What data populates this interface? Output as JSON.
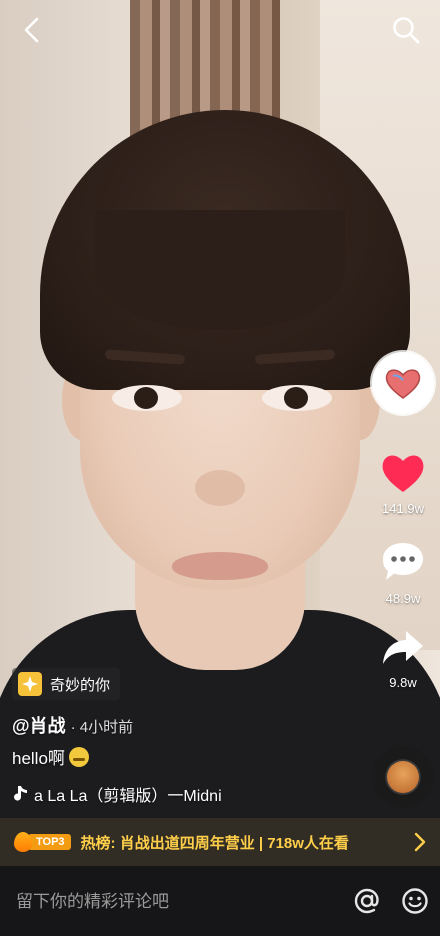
{
  "nav": {
    "back_icon": "chevron-left-icon",
    "search_icon": "search-icon"
  },
  "actions": {
    "like_count": "141.9w",
    "comment_count": "48.9w",
    "share_count": "9.8w"
  },
  "effect": {
    "label": "奇妙的你"
  },
  "post": {
    "author": "@肖战",
    "time": "· 4小时前",
    "caption": "hello啊",
    "music": "a La La（剪辑版）一Midni"
  },
  "hot": {
    "badge": "TOP3",
    "text": "热榜: 肖战出道四周年营业 | 718w人在看"
  },
  "comment_bar": {
    "placeholder": "留下你的精彩评论吧"
  },
  "colors": {
    "like": "#fe2c55",
    "hot_text": "#ffcf4a",
    "badge": "#f39c12"
  }
}
